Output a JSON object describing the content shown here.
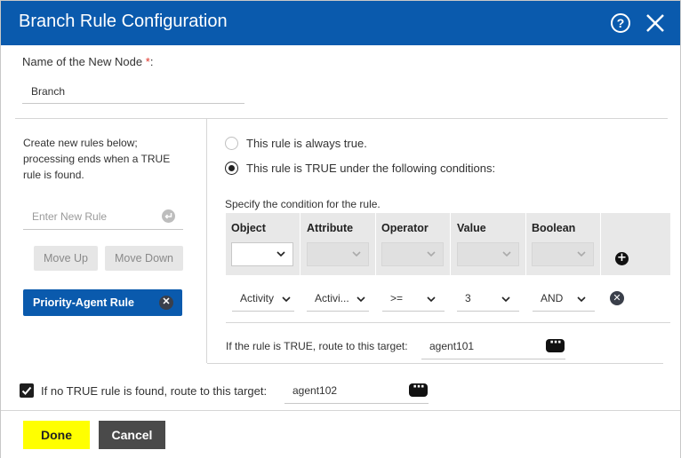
{
  "dialog": {
    "title": "Branch Rule Configuration",
    "help_symbol": "?",
    "header_color": "#0a5aad"
  },
  "node_name": {
    "label": "Name of the New Node",
    "required_marker": "*",
    "label_suffix": ":",
    "value": "Branch"
  },
  "left_panel": {
    "instructions": "Create new rules below; processing ends when a TRUE rule is found.",
    "new_rule_placeholder": "Enter New Rule",
    "move_up_label": "Move Up",
    "move_down_label": "Move Down",
    "rules": [
      {
        "label": "Priority-Agent Rule",
        "selected": true
      }
    ]
  },
  "rule_options": {
    "always_true_label": "This rule is always true.",
    "conditional_label": "This rule is TRUE under the following conditions:",
    "selected": "conditional"
  },
  "conditions": {
    "instruction": "Specify the condition for the rule.",
    "columns": [
      "Object",
      "Attribute",
      "Operator",
      "Value",
      "Boolean"
    ],
    "rows": [
      {
        "object": "Activity",
        "attribute": "Activi...",
        "operator": ">=",
        "value": "3",
        "boolean": "AND"
      }
    ],
    "target_label": "If the rule is TRUE, route to this target:",
    "target_value": "agent101"
  },
  "fallback": {
    "checked": true,
    "label": "If no TRUE rule is found, route to this target:",
    "target_value": "agent102"
  },
  "footer": {
    "done_label": "Done",
    "cancel_label": "Cancel",
    "done_color": "#ffff00",
    "cancel_color": "#4a4a4a"
  }
}
